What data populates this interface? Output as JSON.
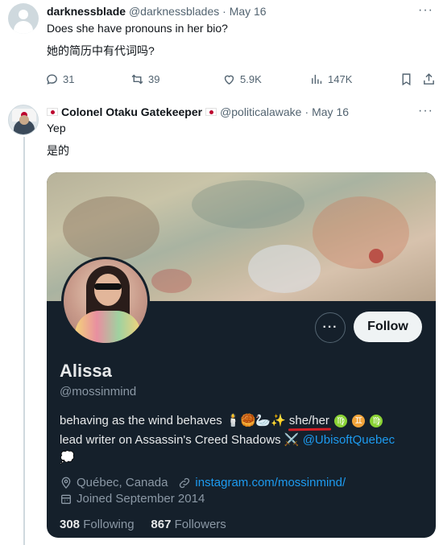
{
  "tweet1": {
    "name": "darknessblade",
    "handle": "@darknessblades",
    "date": "May 16",
    "text": "Does she have pronouns in her bio?",
    "translation": "她的简历中有代词吗?",
    "actions": {
      "replies": "31",
      "retweets": "39",
      "likes": "5.9K",
      "views": "147K"
    }
  },
  "tweet2": {
    "name": "Colonel Otaku Gatekeeper",
    "handle": "@politicalawake",
    "date": "May 16",
    "text": "Yep",
    "translation": "是的"
  },
  "profile_card": {
    "name": "Alissa",
    "handle": "@mossinmind",
    "bio_line1": "behaving as the wind behaves",
    "bio_emojis": "🕯️🥮🦢✨",
    "pronouns": "she/her",
    "zodiac": [
      "♍",
      "♊",
      "♍"
    ],
    "bio_line2": "lead writer on Assassin's Creed Shadows",
    "bio_line2_emoji": "⚔️",
    "bio_link": "@UbisoftQuebec",
    "bio_line3_emoji": "💭",
    "location": "Québec, Canada",
    "website": "instagram.com/mossinmind/",
    "joined": "Joined September 2014",
    "following_count": "308",
    "following_label": "Following",
    "followers_count": "867",
    "followers_label": "Followers",
    "follow_button": "Follow",
    "more_button": "···"
  },
  "colors": {
    "link": "#1d9bf0",
    "card_bg": "#15202b",
    "pronoun_underline": "#d61f26"
  }
}
